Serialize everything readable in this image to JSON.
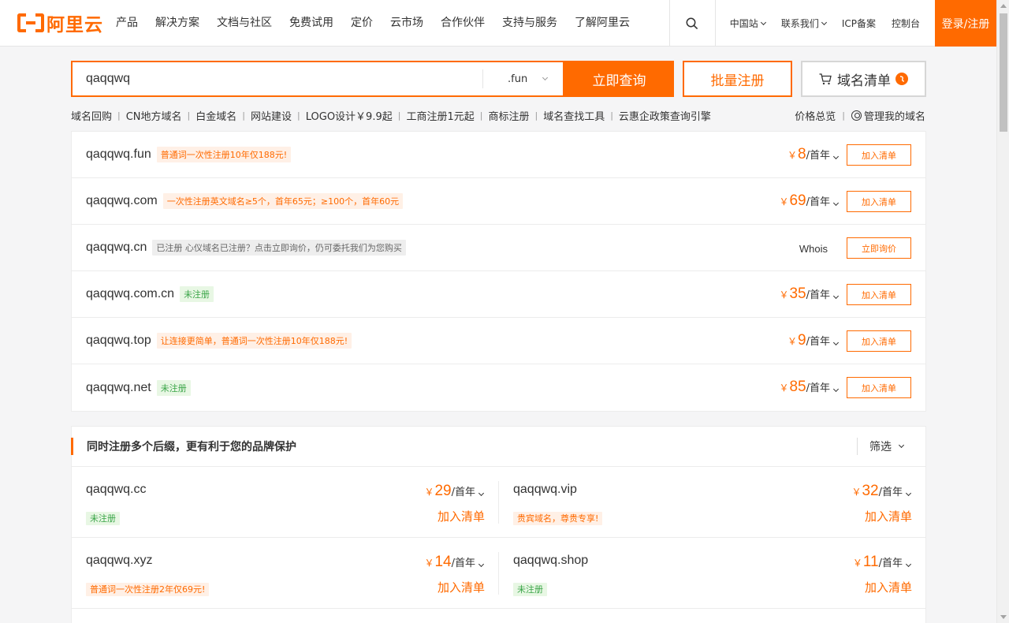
{
  "brand": {
    "logo_text": "阿里云",
    "accent": "#ff6a00"
  },
  "nav": {
    "items": [
      "产品",
      "解决方案",
      "文档与社区",
      "免费试用",
      "定价",
      "云市场",
      "合作伙伴",
      "支持与服务",
      "了解阿里云"
    ],
    "search_icon": "search-icon",
    "region": "中国站",
    "contact": "联系我们",
    "icp": "ICP备案",
    "console": "控制台",
    "login": "登录/注册"
  },
  "search": {
    "value": "qaqqwq",
    "suffix": ".fun",
    "query_btn": "立即查询",
    "bulk_btn": "批量注册",
    "list_btn": "域名清单"
  },
  "quick_links": [
    "域名回购",
    "CN地方域名",
    "白金域名",
    "网站建设",
    "LOGO设计￥9.9起",
    "工商注册1元起",
    "商标注册",
    "域名查找工具",
    "云惠企政策查询引擎"
  ],
  "quick_right": {
    "price_overview": "价格总览",
    "manage": "管理我的域名"
  },
  "results": [
    {
      "name": "qaqqwq.fun",
      "tag": "普通词一次性注册10年仅188元!",
      "tag_type": "promo",
      "currency": "￥",
      "price": "8",
      "unit": "/首年",
      "action": "加入清单"
    },
    {
      "name": "qaqqwq.com",
      "tag": "一次性注册英文域名≥5个，首年65元；≥100个，首年60元",
      "tag_type": "promo",
      "currency": "￥",
      "price": "69",
      "unit": "/首年",
      "action": "加入清单"
    },
    {
      "name": "qaqqwq.cn",
      "tag": "已注册 心仪域名已注册？点击立即询价，仍可委托我们为您购买",
      "tag_type": "gray",
      "whois": "Whois",
      "action": "立即询价"
    },
    {
      "name": "qaqqwq.com.cn",
      "tag": "未注册",
      "tag_type": "green",
      "currency": "￥",
      "price": "35",
      "unit": "/首年",
      "action": "加入清单"
    },
    {
      "name": "qaqqwq.top",
      "tag": "让连接更简单，普通词一次性注册10年仅188元!",
      "tag_type": "promo",
      "currency": "￥",
      "price": "9",
      "unit": "/首年",
      "action": "加入清单"
    },
    {
      "name": "qaqqwq.net",
      "tag": "未注册",
      "tag_type": "green",
      "currency": "￥",
      "price": "85",
      "unit": "/首年",
      "action": "加入清单"
    }
  ],
  "recommend": {
    "title": "同时注册多个后缀，更有利于您的品牌保护",
    "filter": "筛选",
    "items": [
      {
        "name": "qaqqwq.cc",
        "tag": "未注册",
        "tag_type": "green",
        "currency": "￥",
        "price": "29",
        "unit": "/首年",
        "action": "加入清单"
      },
      {
        "name": "qaqqwq.vip",
        "tag": "贵宾域名，尊贵专享!",
        "tag_type": "promo",
        "currency": "￥",
        "price": "32",
        "unit": "/首年",
        "action": "加入清单"
      },
      {
        "name": "qaqqwq.xyz",
        "tag": "普通词一次性注册2年仅69元!",
        "tag_type": "promo",
        "currency": "￥",
        "price": "14",
        "unit": "/首年",
        "action": "加入清单"
      },
      {
        "name": "qaqqwq.shop",
        "tag": "未注册",
        "tag_type": "green",
        "currency": "￥",
        "price": "11",
        "unit": "/首年",
        "action": "加入清单"
      }
    ]
  }
}
